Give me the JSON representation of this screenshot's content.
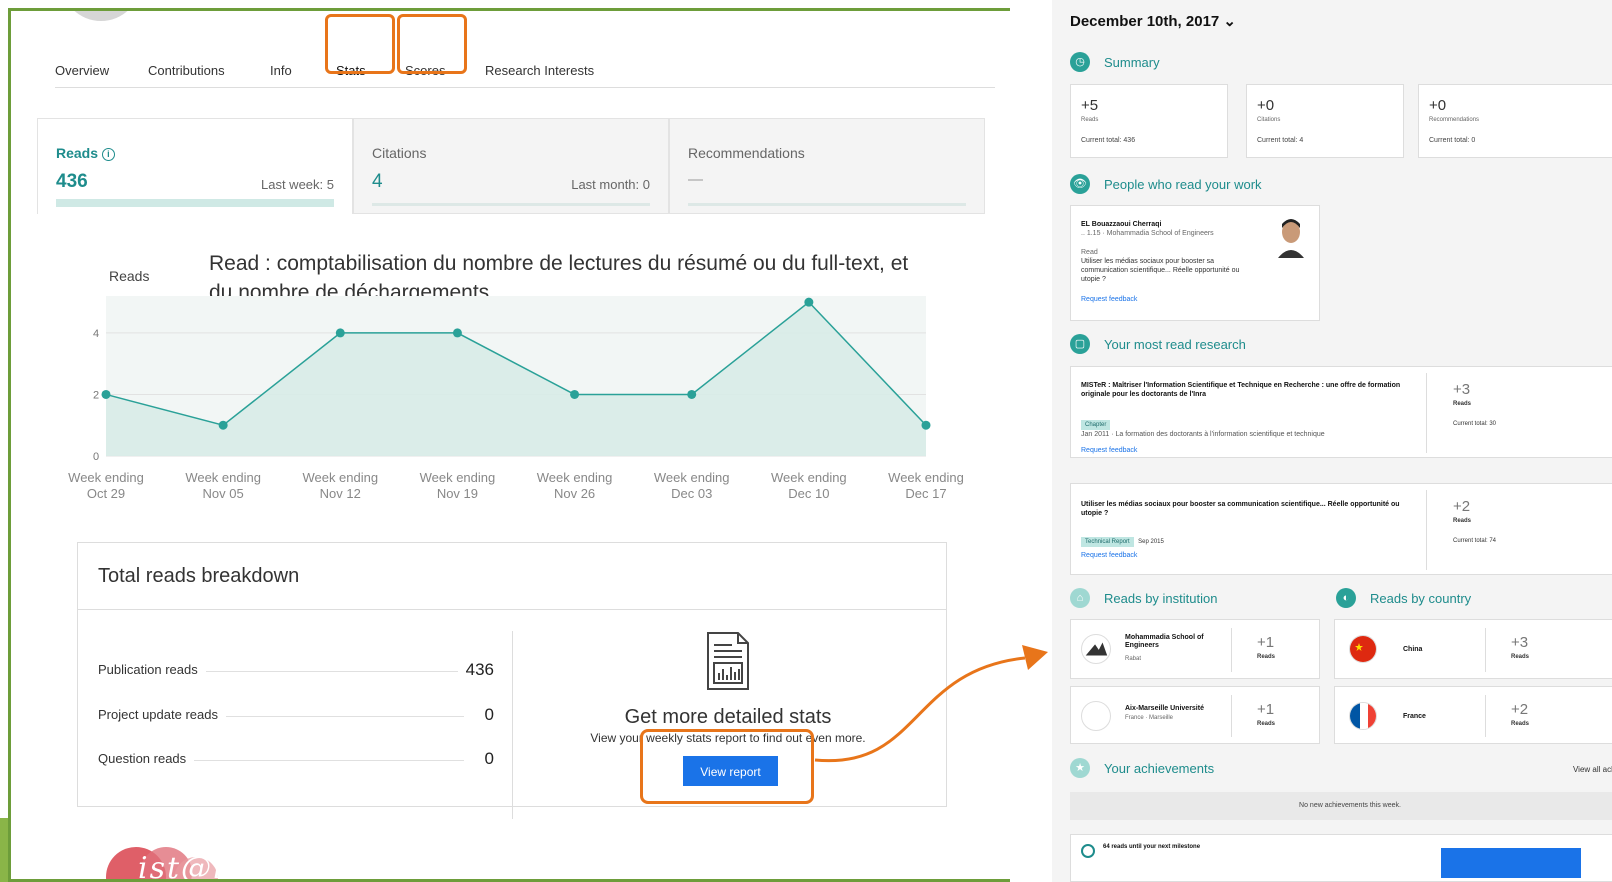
{
  "left": {
    "tabs": [
      {
        "label": "Overview"
      },
      {
        "label": "Contributions"
      },
      {
        "label": "Info"
      },
      {
        "label": "Stats"
      },
      {
        "label": "Scores"
      },
      {
        "label": "Research Interests"
      }
    ],
    "metrics": {
      "reads": {
        "label": "Reads",
        "value": "436",
        "sub": "Last week: 5"
      },
      "citations": {
        "label": "Citations",
        "value": "4",
        "sub": "Last month: 0"
      },
      "recommendations": {
        "label": "Recommendations",
        "value": "—"
      }
    },
    "annotation": "Read : comptabilisation du nombre de lectures du résumé ou du full-text, et du nombre de  déchargements",
    "chart_data": {
      "type": "area",
      "title": "",
      "ylabel": "Reads",
      "xlabel": "",
      "ylim": [
        0,
        5
      ],
      "yticks": [
        "0",
        "2",
        "4"
      ],
      "categories": [
        "Week ending Oct 29",
        "Week ending Nov 05",
        "Week ending Nov 12",
        "Week ending Nov 19",
        "Week ending Nov 26",
        "Week ending Dec 03",
        "Week ending Dec 10",
        "Week ending Dec 17"
      ],
      "category_lines": [
        [
          "Week ending",
          "Oct 29"
        ],
        [
          "Week ending",
          "Nov 05"
        ],
        [
          "Week ending",
          "Nov 12"
        ],
        [
          "Week ending",
          "Nov 19"
        ],
        [
          "Week ending",
          "Nov 26"
        ],
        [
          "Week ending",
          "Dec 03"
        ],
        [
          "Week ending",
          "Dec 10"
        ],
        [
          "Week ending",
          "Dec 17"
        ]
      ],
      "series": [
        {
          "values": [
            2,
            1,
            4,
            4,
            2,
            2,
            5,
            1
          ]
        }
      ],
      "grid": true,
      "color": "#2aa198"
    },
    "breakdown": {
      "title": "Total reads breakdown",
      "rows": [
        {
          "label": "Publication reads",
          "value": "436"
        },
        {
          "label": "Project update reads",
          "value": "0"
        },
        {
          "label": "Question reads",
          "value": "0"
        }
      ],
      "report_title": "Get more detailed stats",
      "report_desc": "View your weekly stats report to find out even more.",
      "report_button": "View report"
    },
    "logo_text": "ist@inra"
  },
  "right": {
    "date": "December 10th, 2017 ⌄",
    "summary": {
      "title": "Summary",
      "cards": [
        {
          "value": "+5",
          "label": "Reads",
          "total": "Current total: 436"
        },
        {
          "value": "+0",
          "label": "Citations",
          "total": "Current total: 4"
        },
        {
          "value": "+0",
          "label": "Recommendations",
          "total": "Current total: 0"
        }
      ]
    },
    "people": {
      "title": "People who read your work",
      "name": "EL Bouazzaoui Cherraqi",
      "meta": ".. 1.15 · Mohammadia School of Engineers",
      "read_label": "Read",
      "read_title": "Utiliser les médias sociaux pour booster sa communication scientifique... Réelle opportunité ou utopie ?",
      "feedback": "Request feedback"
    },
    "most_read": {
      "title": "Your most read research",
      "items": [
        {
          "title": "MISTeR : Maîtriser l'Information Scientifique et Technique en Recherche : une offre de formation originale pour les doctorants de l'Inra",
          "chip": "Chapter",
          "date_line": "Jan 2011 · La formation des doctorants à l'information scientifique et technique",
          "feedback": "Request feedback",
          "delta": "+3",
          "delta_label": "Reads",
          "total": "Current total: 30"
        },
        {
          "title": "Utiliser les médias sociaux pour booster sa communication scientifique... Réelle opportunité ou utopie ?",
          "chip": "Technical Report",
          "date_line": "Sep 2015",
          "feedback": "Request feedback",
          "delta": "+2",
          "delta_label": "Reads",
          "total": "Current total: 74"
        }
      ]
    },
    "by_institution": {
      "title": "Reads by institution",
      "items": [
        {
          "name": "Mohammadia School of Engineers",
          "loc": "Rabat",
          "delta": "+1",
          "delta_label": "Reads"
        },
        {
          "name": "Aix-Marseille Université",
          "loc": "France · Marseille",
          "delta": "+1",
          "delta_label": "Reads"
        }
      ]
    },
    "by_country": {
      "title": "Reads by country",
      "items": [
        {
          "name": "China",
          "delta": "+3",
          "delta_label": "Reads"
        },
        {
          "name": "France",
          "delta": "+2",
          "delta_label": "Reads"
        }
      ]
    },
    "achievements": {
      "title": "Your achievements",
      "view_all": "View all achievements",
      "none": "No new achievements this week.",
      "milestone": "64 reads until your next milestone"
    }
  }
}
